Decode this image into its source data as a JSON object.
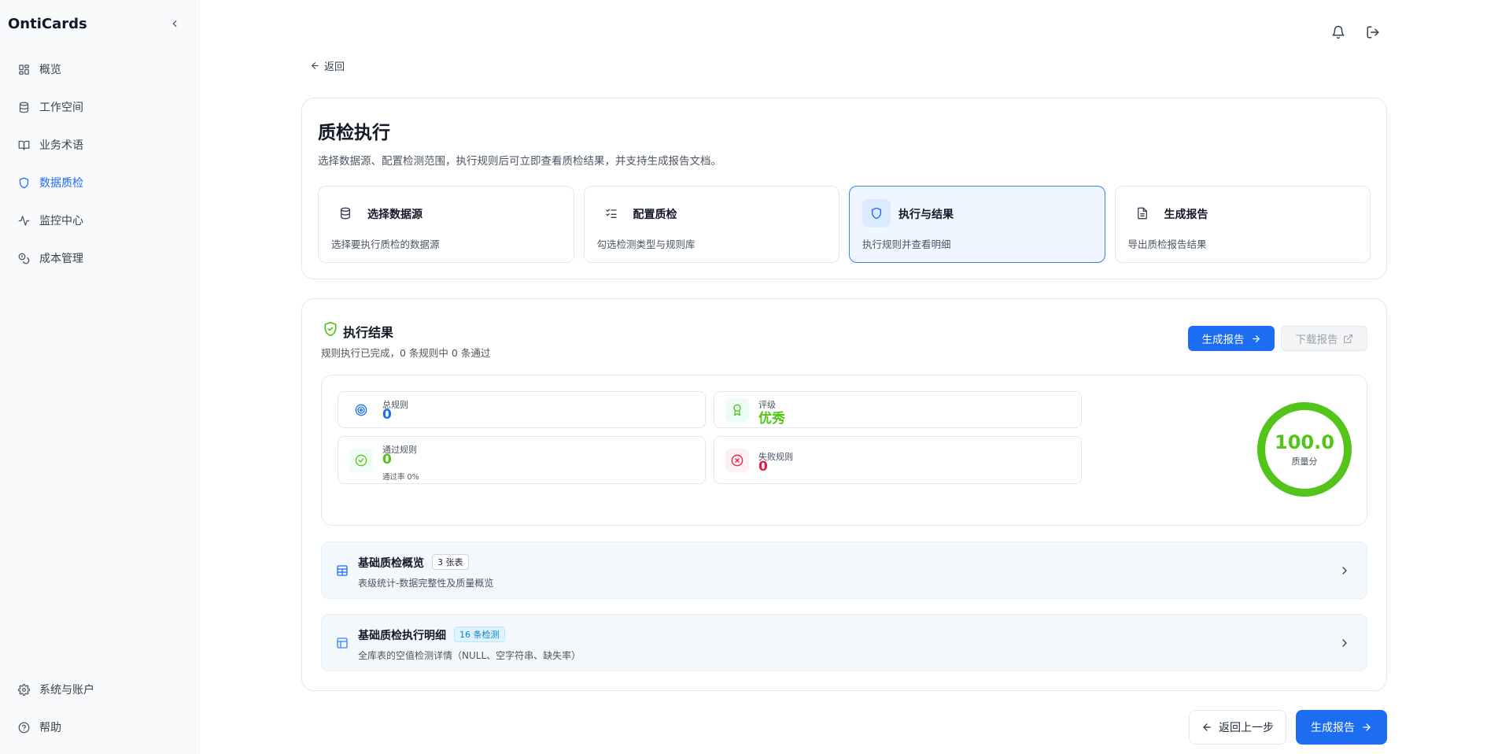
{
  "app": {
    "title": "OntiCards"
  },
  "sidebar": {
    "items": [
      {
        "label": "概览",
        "icon": "dashboard-icon"
      },
      {
        "label": "工作空间",
        "icon": "database-icon"
      },
      {
        "label": "业务术语",
        "icon": "book-icon"
      },
      {
        "label": "数据质检",
        "icon": "shield-icon",
        "active": true
      },
      {
        "label": "监控中心",
        "icon": "activity-icon"
      },
      {
        "label": "成本管理",
        "icon": "coins-icon"
      }
    ],
    "bottom": [
      {
        "label": "系统与账户",
        "icon": "gear-icon"
      },
      {
        "label": "帮助",
        "icon": "help-icon"
      }
    ]
  },
  "header": {
    "back_label": "返回"
  },
  "page": {
    "title": "质检执行",
    "description": "选择数据源、配置检测范围，执行规则后可立即查看质检结果，并支持生成报告文档。"
  },
  "steps": [
    {
      "title": "选择数据源",
      "desc": "选择要执行质检的数据源"
    },
    {
      "title": "配置质检",
      "desc": "勾选检测类型与规则库"
    },
    {
      "title": "执行与结果",
      "desc": "执行规则并查看明细",
      "active": true
    },
    {
      "title": "生成报告",
      "desc": "导出质检报告结果"
    }
  ],
  "results": {
    "title": "执行结果",
    "subtitle": "规则执行已完成，0 条规则中 0 条通过",
    "generate_label": "生成报告",
    "download_label": "下载报告",
    "stats": {
      "total": {
        "label": "总规则",
        "value": "0"
      },
      "grade": {
        "label": "评级",
        "value": "优秀"
      },
      "passed": {
        "label": "通过规则",
        "value": "0",
        "note": "通过率 0%"
      },
      "failed": {
        "label": "失败规则",
        "value": "0"
      }
    },
    "score": {
      "value": "100.0",
      "label": "质量分",
      "fraction": 1.0
    },
    "rows": [
      {
        "title": "基础质检概览",
        "badge": "3 张表",
        "desc": "表级统计-数据完整性及质量概览"
      },
      {
        "title": "基础质检执行明细",
        "badge": "16 条检测",
        "desc": "全库表的空值检测详情（NULL、空字符串、缺失率）"
      }
    ]
  },
  "footer": {
    "prev_label": "返回上一步",
    "generate_label": "生成报告"
  },
  "colors": {
    "accent": "#1d6df2",
    "success": "#52c41a",
    "danger": "#e11d48"
  }
}
